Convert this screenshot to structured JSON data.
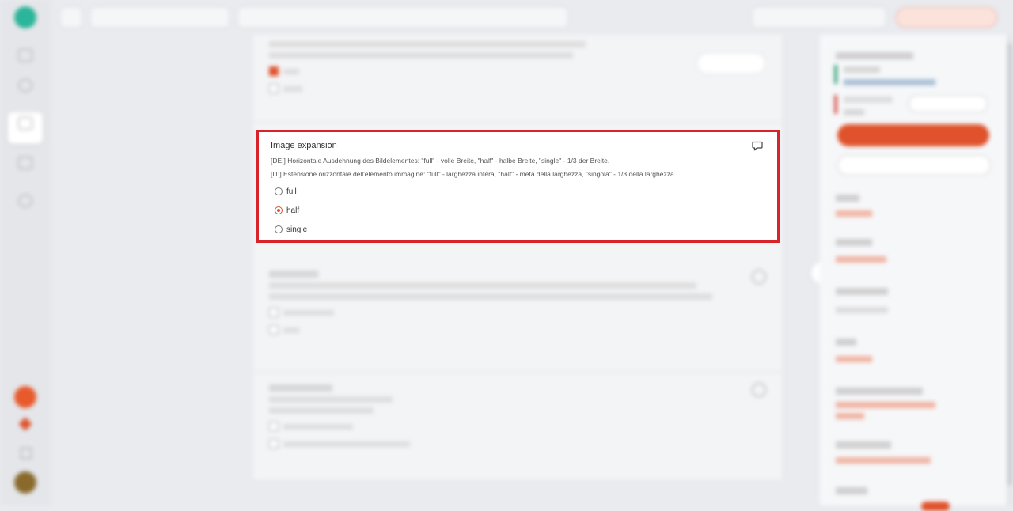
{
  "panel": {
    "title": "Image expansion",
    "desc_de": "[DE:] Horizontale Ausdehnung des Bildelementes: \"full\" - volle Breite, \"half\" - halbe Breite, \"single\" - 1/3 der Breite.",
    "desc_it": "[IT:] Estensione orizzontale dell'elemento immagine: \"full\" - larghezza intera, \"half\" - metà della larghezza, \"singola\" - 1/3 della larghezza.",
    "comment_icon": "comment-icon",
    "options": [
      {
        "label": "full",
        "selected": false
      },
      {
        "label": "half",
        "selected": true
      },
      {
        "label": "single",
        "selected": false
      }
    ]
  },
  "colors": {
    "highlight_border": "#d8232a",
    "accent": "#d9532f"
  }
}
